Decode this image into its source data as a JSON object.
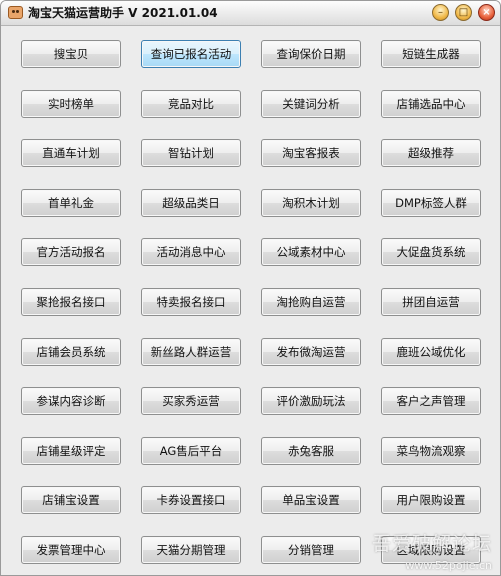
{
  "window": {
    "title": "淘宝天猫运营助手 V 2021.01.04",
    "minimize_glyph": "–",
    "maximize_glyph": "□",
    "close_glyph": "×",
    "accent_active": "#bee6fd",
    "close_color": "#e8603a"
  },
  "buttons": [
    [
      "搜宝贝",
      "查询已报名活动",
      "查询保价日期",
      "短链生成器"
    ],
    [
      "实时榜单",
      "竞品对比",
      "关键词分析",
      "店铺选品中心"
    ],
    [
      "直通车计划",
      "智钻计划",
      "淘宝客报表",
      "超级推荐"
    ],
    [
      "首单礼金",
      "超级品类日",
      "淘积木计划",
      "DMP标签人群"
    ],
    [
      "官方活动报名",
      "活动消息中心",
      "公域素材中心",
      "大促盘货系统"
    ],
    [
      "聚抢报名接口",
      "特卖报名接口",
      "淘抢购自运营",
      "拼团自运营"
    ],
    [
      "店铺会员系统",
      "新丝路人群运营",
      "发布微淘运营",
      "鹿班公域优化"
    ],
    [
      "参谋内容诊断",
      "买家秀运营",
      "评价激励玩法",
      "客户之声管理"
    ],
    [
      "店铺星级评定",
      "AG售后平台",
      "赤兔客服",
      "菜鸟物流观察"
    ],
    [
      "店铺宝设置",
      "卡券设置接口",
      "单品宝设置",
      "用户限购设置"
    ],
    [
      "发票管理中心",
      "天猫分期管理",
      "分销管理",
      "区域限购设置"
    ]
  ],
  "active_button": "查询已报名活动",
  "watermark": {
    "text": "吾爱破解论坛",
    "url": "www.52pojie.cn"
  }
}
